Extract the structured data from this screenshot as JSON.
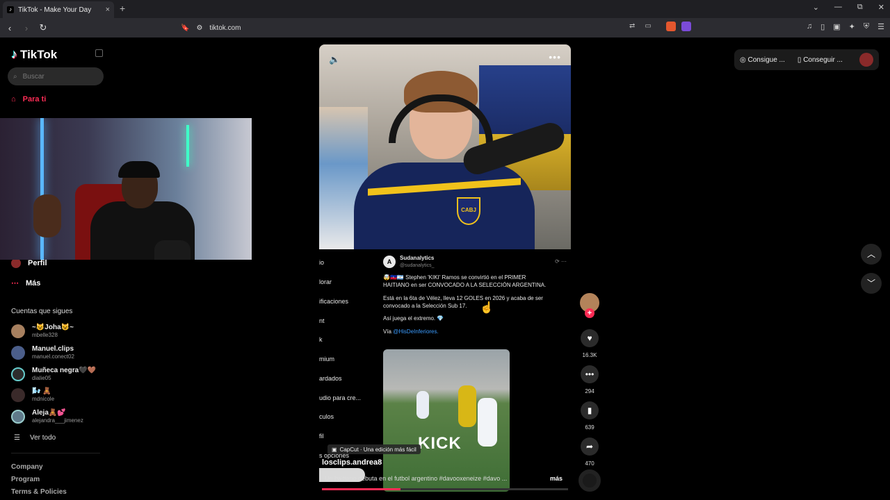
{
  "browser": {
    "tab_title": "TikTok - Make Your Day",
    "tab_close": "×",
    "new_tab": "+",
    "url": "tiktok.com",
    "window_controls": [
      "⌄",
      "—",
      "⧉",
      "✕"
    ],
    "nav": {
      "back": "‹",
      "forward": "›",
      "reload": "↻"
    }
  },
  "sidebar": {
    "logo_text": "TikTok",
    "search_placeholder": "Buscar",
    "nav_for_you": "Para ti",
    "nav_profile": "Perfil",
    "nav_more": "Más",
    "following_title": "Cuentas que sigues",
    "following": [
      {
        "name": "~😺Joha😺~",
        "handle": "mbelle328"
      },
      {
        "name": "Manuel.clips",
        "handle": "manuel.conect02"
      },
      {
        "name": "Muñeca negra🖤🤎",
        "handle": "dialie05"
      },
      {
        "name": "🌬️ 🧸",
        "handle": "mdnicole"
      },
      {
        "name": "Aleja🧸💕",
        "handle": "alejandra___jimenez"
      }
    ],
    "see_all": "Ver todo",
    "footer": [
      "Company",
      "Program",
      "Terms & Policies"
    ]
  },
  "video": {
    "tweet": {
      "avatar": "A",
      "name": "Sudanalytics",
      "handle": "@sudanalytics_",
      "p1": "🤯🇭🇹🇦🇷 Stephen 'KIKI' Ramos se convirtió en el PRIMER HAITIANO en ser CONVOCADO A LA SELECCIÓN ARGENTINA.",
      "p2": "Está en la 6ta de Vélez, lleva 12 GOLES en 2026 y acaba de ser convocado a la Selección Sub 17.",
      "p3": "Así juega el extremo. 💎",
      "via": "Vía",
      "via_link": "@HisDeInferiores."
    },
    "menu_fragments": [
      "io",
      "lorar",
      "ificaciones",
      "nt",
      "k",
      "mium",
      "ardados",
      "udio para cre...",
      "culos",
      "fil",
      "s opciones"
    ],
    "image_text": "KICK",
    "capcut": "CapCut · Una edición más fácil",
    "author": "losclips.andrea8",
    "caption": "Un haitiano debuta en el futbol argentino #davooxeneize #davo ...",
    "more": "más",
    "progress": 0.32
  },
  "actions": {
    "likes": "16.3K",
    "comments": "294",
    "saves": "639",
    "shares": "470"
  },
  "top_right": {
    "coins": "Consigue ...",
    "app": "Conseguir ..."
  }
}
